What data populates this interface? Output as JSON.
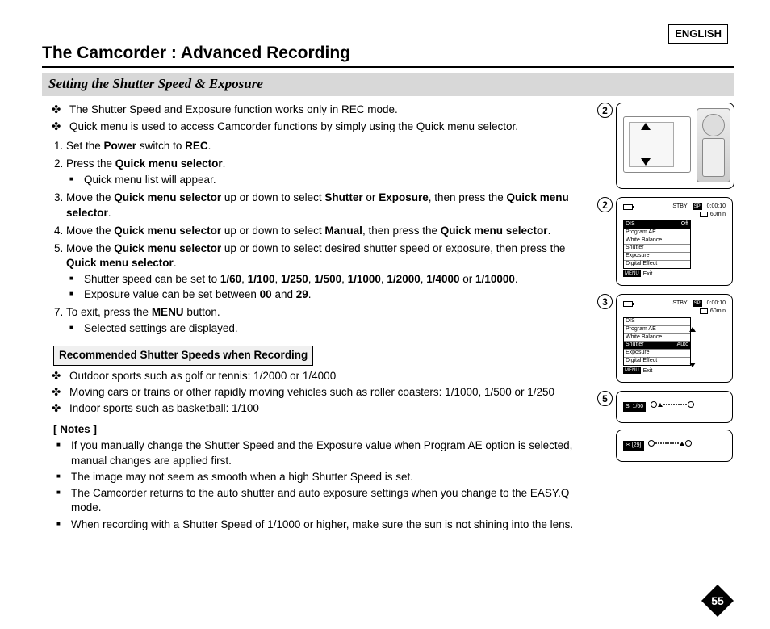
{
  "language": "ENGLISH",
  "title": "The Camcorder : Advanced Recording",
  "subtitle": "Setting the Shutter Speed & Exposure",
  "intro": [
    "The Shutter Speed and Exposure function works only in REC mode.",
    "Quick menu is used to access Camcorder functions by simply using the Quick menu selector."
  ],
  "steps": {
    "s1_a": "Set the ",
    "s1_b": "Power",
    "s1_c": " switch to ",
    "s1_d": "REC",
    "s1_e": ".",
    "s2_a": "Press the ",
    "s2_b": "Quick menu selector",
    "s2_c": ".",
    "s2_sub": "Quick menu list will appear.",
    "s3_a": "Move the ",
    "s3_b": "Quick menu selector",
    "s3_c": " up or down to select ",
    "s3_d": "Shutter",
    "s3_e": " or ",
    "s3_f": "Exposure",
    "s3_g": ", then press the ",
    "s3_h": "Quick menu selector",
    "s3_i": ".",
    "s4_a": "Move the ",
    "s4_b": "Quick menu selector",
    "s4_c": " up or down to select ",
    "s4_d": "Manual",
    "s4_e": ", then press the ",
    "s4_f": "Quick menu selector",
    "s4_g": ".",
    "s5_a": "Move the ",
    "s5_b": "Quick menu selector",
    "s5_c": " up or down to select desired shutter speed or exposure, then press the ",
    "s5_d": "Quick menu selector",
    "s5_e": ".",
    "s5_sub1_a": "Shutter speed can be set to ",
    "s5_sub1_vals": "1/60, 1/100, 1/250, 1/500, 1/1000, 1/2000, 1/4000 or 1/10000",
    "s5_sub1_b": ".",
    "s5_sub2_a": "Exposure value can be set between ",
    "s5_sub2_b": "00",
    "s5_sub2_c": " and ",
    "s5_sub2_d": "29",
    "s5_sub2_e": ".",
    "s7_a": "To exit, press the ",
    "s7_b": "MENU",
    "s7_c": " button.",
    "s7_sub": "Selected settings are displayed."
  },
  "rec_box": "Recommended Shutter Speeds when Recording",
  "rec_list": [
    "Outdoor sports such as golf or tennis: 1/2000 or 1/4000",
    "Moving cars or trains or other rapidly moving vehicles such as roller coasters: 1/1000, 1/500 or 1/250",
    "Indoor sports such as basketball: 1/100"
  ],
  "notes_title": "[ Notes ]",
  "notes": [
    "If you manually change the Shutter Speed and the Exposure value when Program AE option is selected, manual changes are applied first.",
    "The image may not seem as smooth when a high Shutter Speed is set.",
    "The Camcorder returns to the auto shutter and auto exposure settings when you change to the EASY.Q mode.",
    "When recording with a Shutter Speed of 1/1000 or higher, make sure the sun is not shining into the lens."
  ],
  "diag": {
    "step2": "2",
    "step3": "3",
    "step5": "5",
    "stby": "STBY",
    "sp": "SP",
    "time": "0:00:10",
    "remain": "60min",
    "menu_off": "Off",
    "menu_auto": "Auto",
    "menu_items": [
      "DIS",
      "Program AE",
      "White Balance",
      "Shutter",
      "Exposure",
      "Digital Effect"
    ],
    "menu_exit": "Exit",
    "menu_badge": "MENU",
    "shutter_chip": "S. 1/60",
    "exposure_chip": "[29]",
    "exposure_icon": "✂"
  },
  "page": "55"
}
